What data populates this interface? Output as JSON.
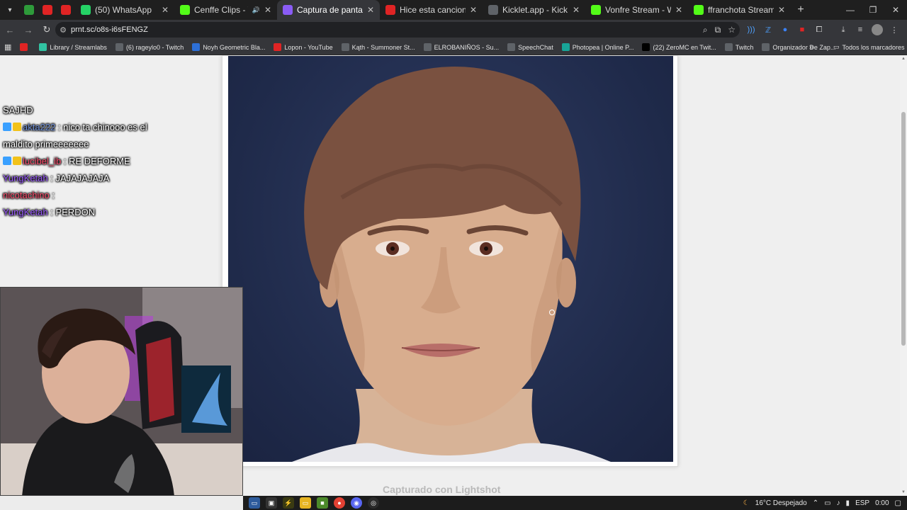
{
  "tabs": [
    {
      "label": "",
      "color": "#2e9b3a",
      "icon": "green-icon",
      "pinned": true
    },
    {
      "label": "",
      "color": "#e02424",
      "icon": "youtube-icon",
      "pinned": true
    },
    {
      "label": "",
      "color": "#e02424",
      "icon": "youtube-icon",
      "pinned": true
    },
    {
      "label": "(50) WhatsApp",
      "color": "#25d366",
      "icon": "whatsapp-icon"
    },
    {
      "label": "Cenffe Clips - Watch Liv",
      "color": "#53fc18",
      "icon": "kick-icon",
      "audio": true
    },
    {
      "label": "Captura de pantalla por Lig",
      "color": "#8a5cf6",
      "icon": "lightshot-icon",
      "active": true
    },
    {
      "label": "Hice esta cancion para la s",
      "color": "#e02424",
      "icon": "youtube-icon"
    },
    {
      "label": "Kicklet.app - Kick Chatbot a",
      "color": "#5f6368",
      "icon": "kicklet-icon"
    },
    {
      "label": "Vonfre Stream - Watch Live",
      "color": "#53fc18",
      "icon": "kick-icon"
    },
    {
      "label": "ffranchota Stream - Wa",
      "color": "#53fc18",
      "icon": "kick-icon"
    }
  ],
  "address": {
    "url": "prnt.sc/o8s-i6sFENGZ"
  },
  "bookmarks": [
    {
      "label": "",
      "color": "#e02424",
      "icon": "youtube-icon"
    },
    {
      "label": "Library / Streamlabs",
      "color": "#31c3a2",
      "icon": "streamlabs-icon"
    },
    {
      "label": "(6) rageylo0 - Twitch",
      "color": "#5f6368",
      "icon": "globe-icon"
    },
    {
      "label": "Noyh Geometric Bla...",
      "color": "#2d6fd6",
      "icon": "noyh-icon"
    },
    {
      "label": "Lopon - YouTube",
      "color": "#e02424",
      "icon": "youtube-icon"
    },
    {
      "label": "Kąth - Summoner St...",
      "color": "#5f6368",
      "icon": "globe-icon"
    },
    {
      "label": "ELROBANIÑOS - Su...",
      "color": "#5f6368",
      "icon": "globe-icon"
    },
    {
      "label": "SpeechChat",
      "color": "#5f6368",
      "icon": "globe-icon"
    },
    {
      "label": "Photopea | Online P...",
      "color": "#18a497",
      "icon": "photopea-icon"
    },
    {
      "label": "(22) ZeroMC en Twit...",
      "color": "#000000",
      "icon": "x-icon"
    },
    {
      "label": "Twitch",
      "color": "#5f6368",
      "icon": "globe-icon"
    },
    {
      "label": "Organizador De Zap...",
      "color": "#5f6368",
      "icon": "globe-icon"
    }
  ],
  "bookmarks_all": "Todos los marcadores",
  "chat": [
    {
      "user": "",
      "message": "SAJHD",
      "color": "#ffffff"
    },
    {
      "user": "akta222",
      "message": ": nico ta chinooo es el maldito primeeeeeee",
      "color": "#6e8fd8",
      "badges": true
    },
    {
      "user": "lucibel_ib",
      "message": ": RE DEFORME",
      "color": "#ff4d6d",
      "badges": true
    },
    {
      "user": "YungKetah",
      "message": ": JAJAJAJAJA",
      "color": "#9b59ff"
    },
    {
      "user": "nicotachino",
      "message": ":",
      "color": "#ff4d6d"
    },
    {
      "user": "YungKetah",
      "message": ": PERDON",
      "color": "#9b59ff"
    }
  ],
  "caption": "Capturado con Lightshot",
  "tray": {
    "weather": "16°C Despejado",
    "lang": "ESP",
    "time": "0:00"
  }
}
